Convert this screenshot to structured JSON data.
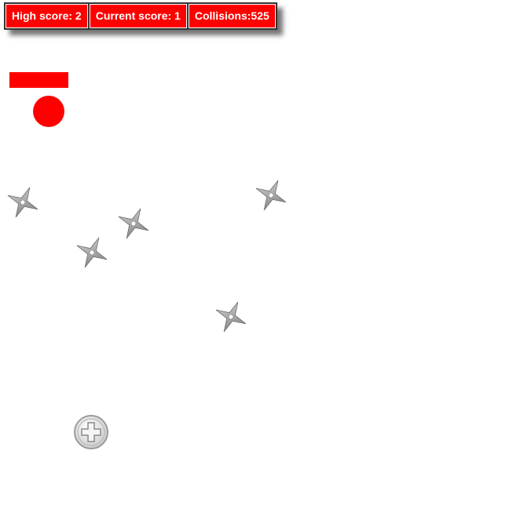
{
  "scoreboard": {
    "high_score": "High score: 2",
    "current_score": "Current score: 1",
    "collisions": "Collisions:525"
  },
  "colors": {
    "accent": "#ff0000",
    "hazard": "#9a9a9a",
    "background": "#ffffff"
  },
  "icons": {
    "hazard": "shuriken-icon",
    "spawn": "plus-icon"
  }
}
